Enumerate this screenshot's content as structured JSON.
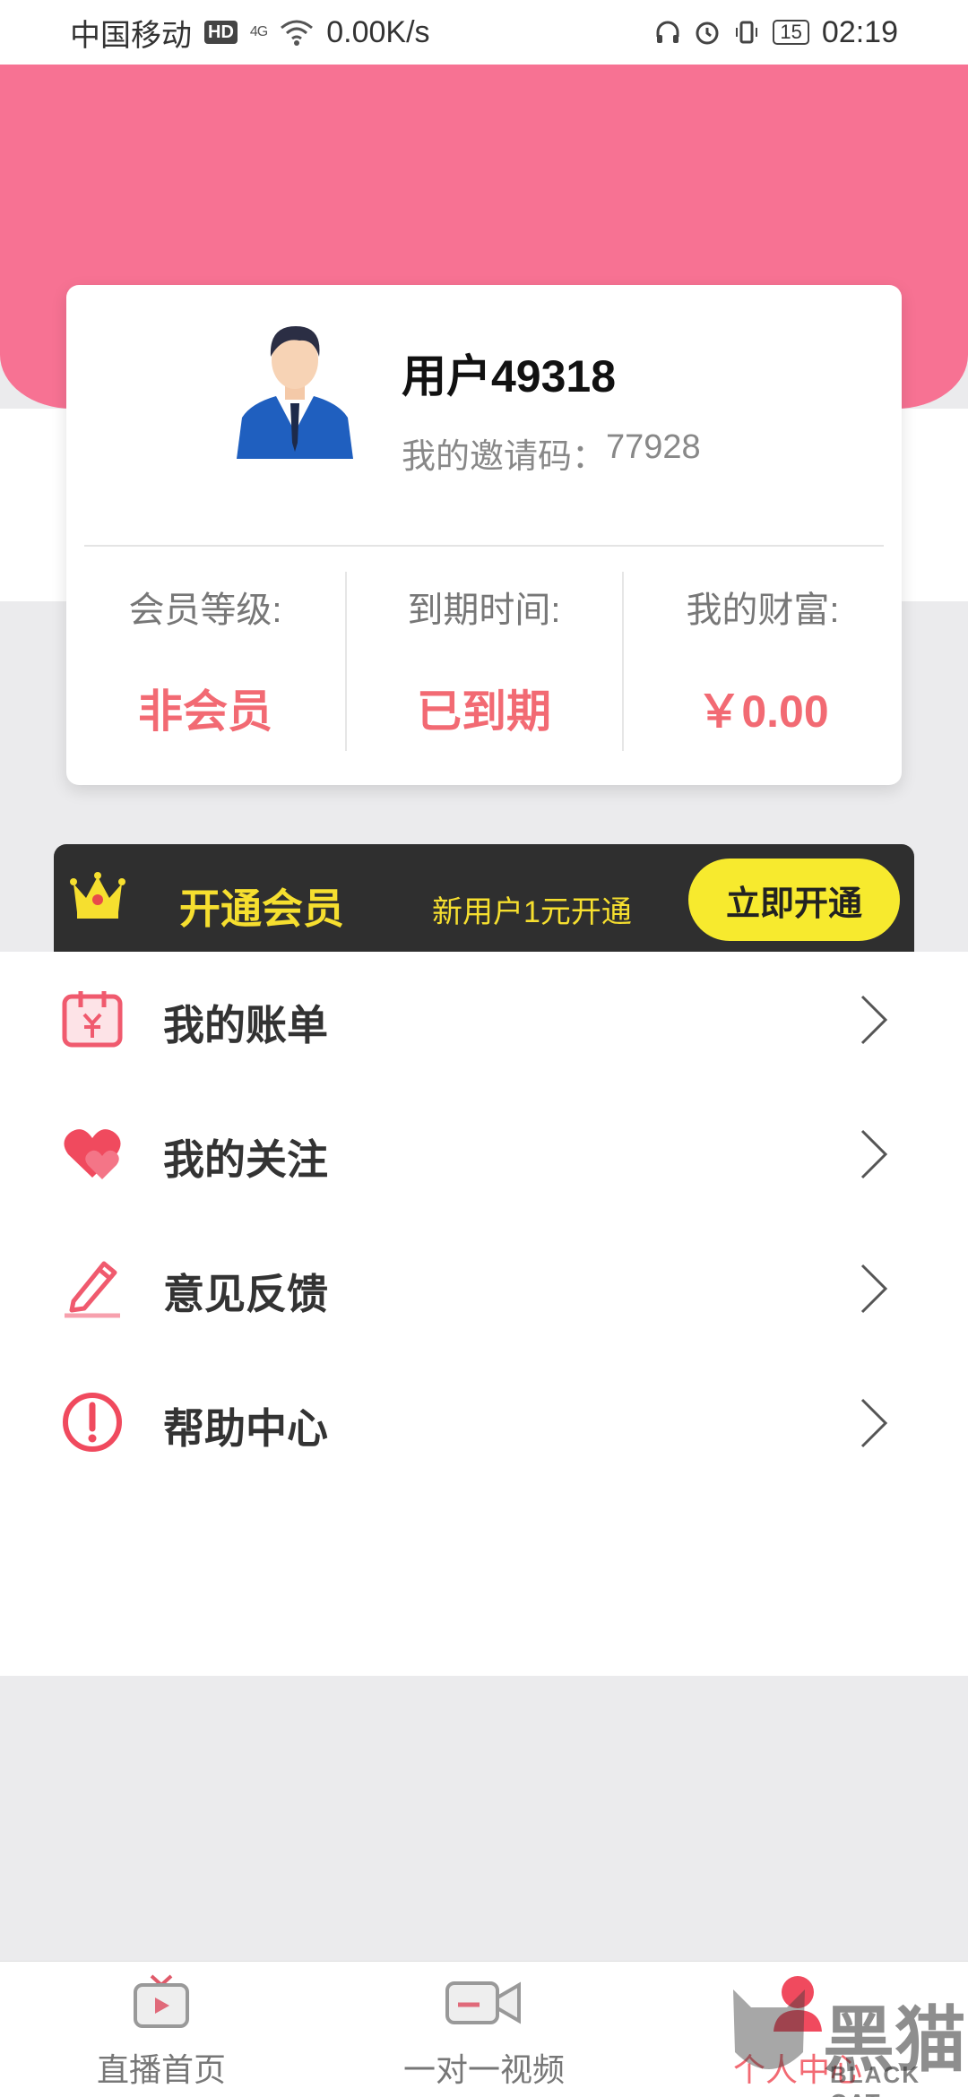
{
  "status_bar": {
    "carrier": "中国移动",
    "hd": "HD",
    "signal": "4G",
    "speed": "0.00K/s",
    "battery": "15",
    "time": "02:19"
  },
  "profile": {
    "username": "用户49318",
    "invite_label": "我的邀请码：",
    "invite_code": "77928"
  },
  "stats": [
    {
      "label": "会员等级:",
      "value": "非会员"
    },
    {
      "label": "到期时间:",
      "value": "已到期"
    },
    {
      "label": "我的财富:",
      "value": "￥0.00"
    }
  ],
  "vip_banner": {
    "title": "开通会员",
    "subtitle": "新用户1元开通",
    "button": "立即开通"
  },
  "menu": [
    {
      "label": "我的账单",
      "icon": "bill-icon"
    },
    {
      "label": "我的关注",
      "icon": "heart-icon"
    },
    {
      "label": "意见反馈",
      "icon": "pencil-icon"
    },
    {
      "label": "帮助中心",
      "icon": "alert-icon"
    }
  ],
  "bottom_nav": [
    {
      "label": "直播首页",
      "icon": "tv-icon"
    },
    {
      "label": "一对一视频",
      "icon": "video-camera-icon"
    },
    {
      "label": "个人中心",
      "icon": "person-icon",
      "active": true
    }
  ],
  "watermark": {
    "text": "黑猫",
    "sub": "BLACK CAT"
  },
  "colors": {
    "header_pink": "#f77293",
    "accent_red": "#f26a73",
    "vip_yellow": "#f6df2f",
    "vip_dark": "#2f2f2f"
  }
}
